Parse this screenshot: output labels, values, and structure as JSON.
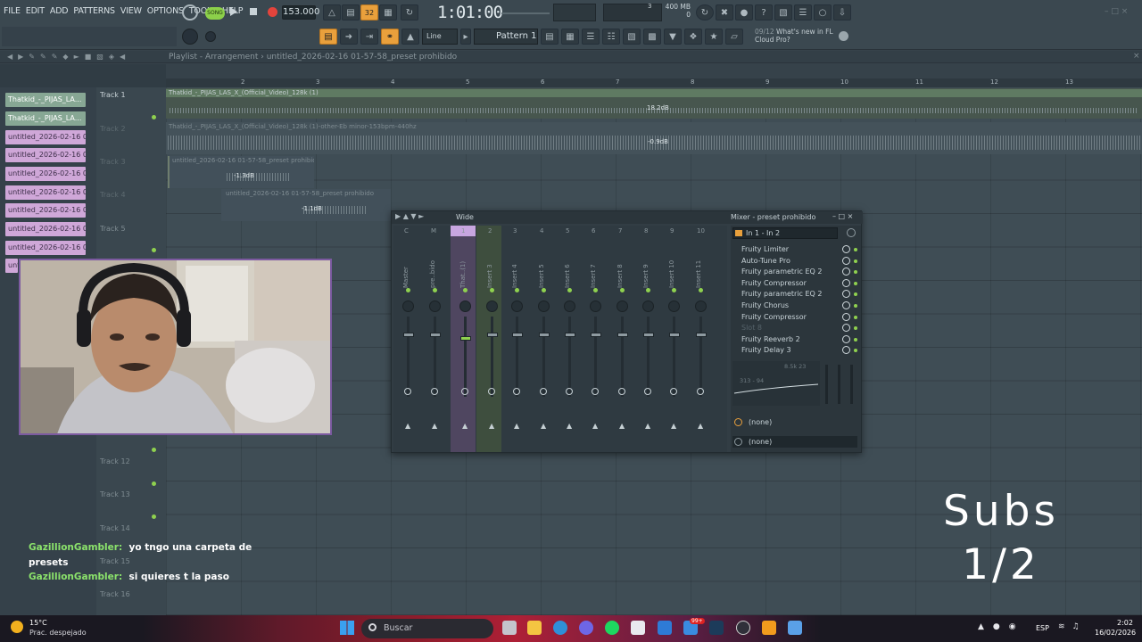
{
  "menu": [
    "FILE",
    "EDIT",
    "ADD",
    "PATTERNS",
    "VIEW",
    "OPTIONS",
    "TOOLS",
    "HELP"
  ],
  "transport": {
    "song_label": "SONG",
    "tempo": "153.000",
    "song_position": "1:01:00",
    "pattern_label": "Pattern 1",
    "line_label": "Line",
    "time_sig": "32"
  },
  "cpu": {
    "memory": "400 MB",
    "value": "3",
    "voices": "0"
  },
  "news": {
    "date": "09/12",
    "line1": "What's new in FL",
    "line2": "Cloud Pro?"
  },
  "playlist": {
    "title": "Playlist - Arrangement",
    "project": "untitled_2026-02-16 01-57-58_preset prohibido",
    "ruler": [
      "2",
      "3",
      "4",
      "5",
      "6",
      "7",
      "8",
      "9",
      "10",
      "11",
      "12",
      "13"
    ],
    "tracks": [
      "Track 1",
      "Track 2",
      "Track 3",
      "Track 4",
      "Track 5",
      "Track 12",
      "Track 13",
      "Track 14",
      "Track 15",
      "Track 16"
    ],
    "clips": [
      {
        "label": "Thatkid_-_PIJAS_LAS_X_(Official_Video)_128k (1)",
        "db": "18.2dB"
      },
      {
        "label": "Thatkid_-_PIJAS_LAS_X_(Official_Video)_128k (1)-other-Eb minor-153bpm-440hz",
        "db": "-0.9dB"
      },
      {
        "label": "untitled_2026-02-16 01-57-58_preset prohibido",
        "db": "-1.3dB"
      },
      {
        "label": "untitled_2026-02-16 01-57-58_preset prohibido",
        "db": "-1.1dB"
      }
    ],
    "picker": [
      "Thatkid_-_PIJAS_LA...",
      "Thatkid_-_PIJAS_LA...",
      "untitled_2026-02-16 01-...",
      "untitled_2026-02-16 01-...",
      "untitled_2026-02-16 01-...",
      "untitled_2026-02-16 01-...",
      "untitled_2026-02-16 01-...",
      "untitled_2026-02-16 01-...",
      "untitled_2026-02-16 01-...",
      "untitled_2026-02-16 01-...",
      "unti"
    ]
  },
  "mixer": {
    "title": "Mixer - preset prohibido",
    "view": "Wide",
    "routing": "In 1 - In 2",
    "strip_numbers": [
      "C",
      "M",
      "1",
      "2",
      "3",
      "4",
      "5",
      "6",
      "7",
      "8",
      "9",
      "10"
    ],
    "strip_names": [
      "Master",
      "pre..bido",
      "That..(1)",
      "Insert 3",
      "Insert 4",
      "Insert 5",
      "Insert 6",
      "Insert 7",
      "Insert 8",
      "Insert 9",
      "Insert 10",
      "Insert 11"
    ],
    "fx": [
      "Fruity Limiter",
      "Auto-Tune Pro",
      "Fruity parametric EQ 2",
      "Fruity Compressor",
      "Fruity parametric EQ 2",
      "Fruity Chorus",
      "Fruity Compressor",
      "Slot 8",
      "Fruity Reeverb 2",
      "Fruity Delay 3"
    ],
    "eq_freq": "313 - 94",
    "eq_hz": "8.5k 23",
    "send_a": "(none)",
    "send_b": "(none)"
  },
  "chat": [
    {
      "user": "GazillionGambler:",
      "msg": "yo tngo una carpeta de presets"
    },
    {
      "user": "GazillionGambler:",
      "msg": "si quieres t la paso"
    }
  ],
  "overlay": {
    "subs_line1": "Subs",
    "subs_line2": "1/2"
  },
  "taskbar": {
    "weather_temp": "15°C",
    "weather_desc": "Prac. despejado",
    "search_placeholder": "Buscar",
    "lang": "ESP",
    "time": "2:02",
    "date": "16/02/2026",
    "badge": "99+"
  }
}
